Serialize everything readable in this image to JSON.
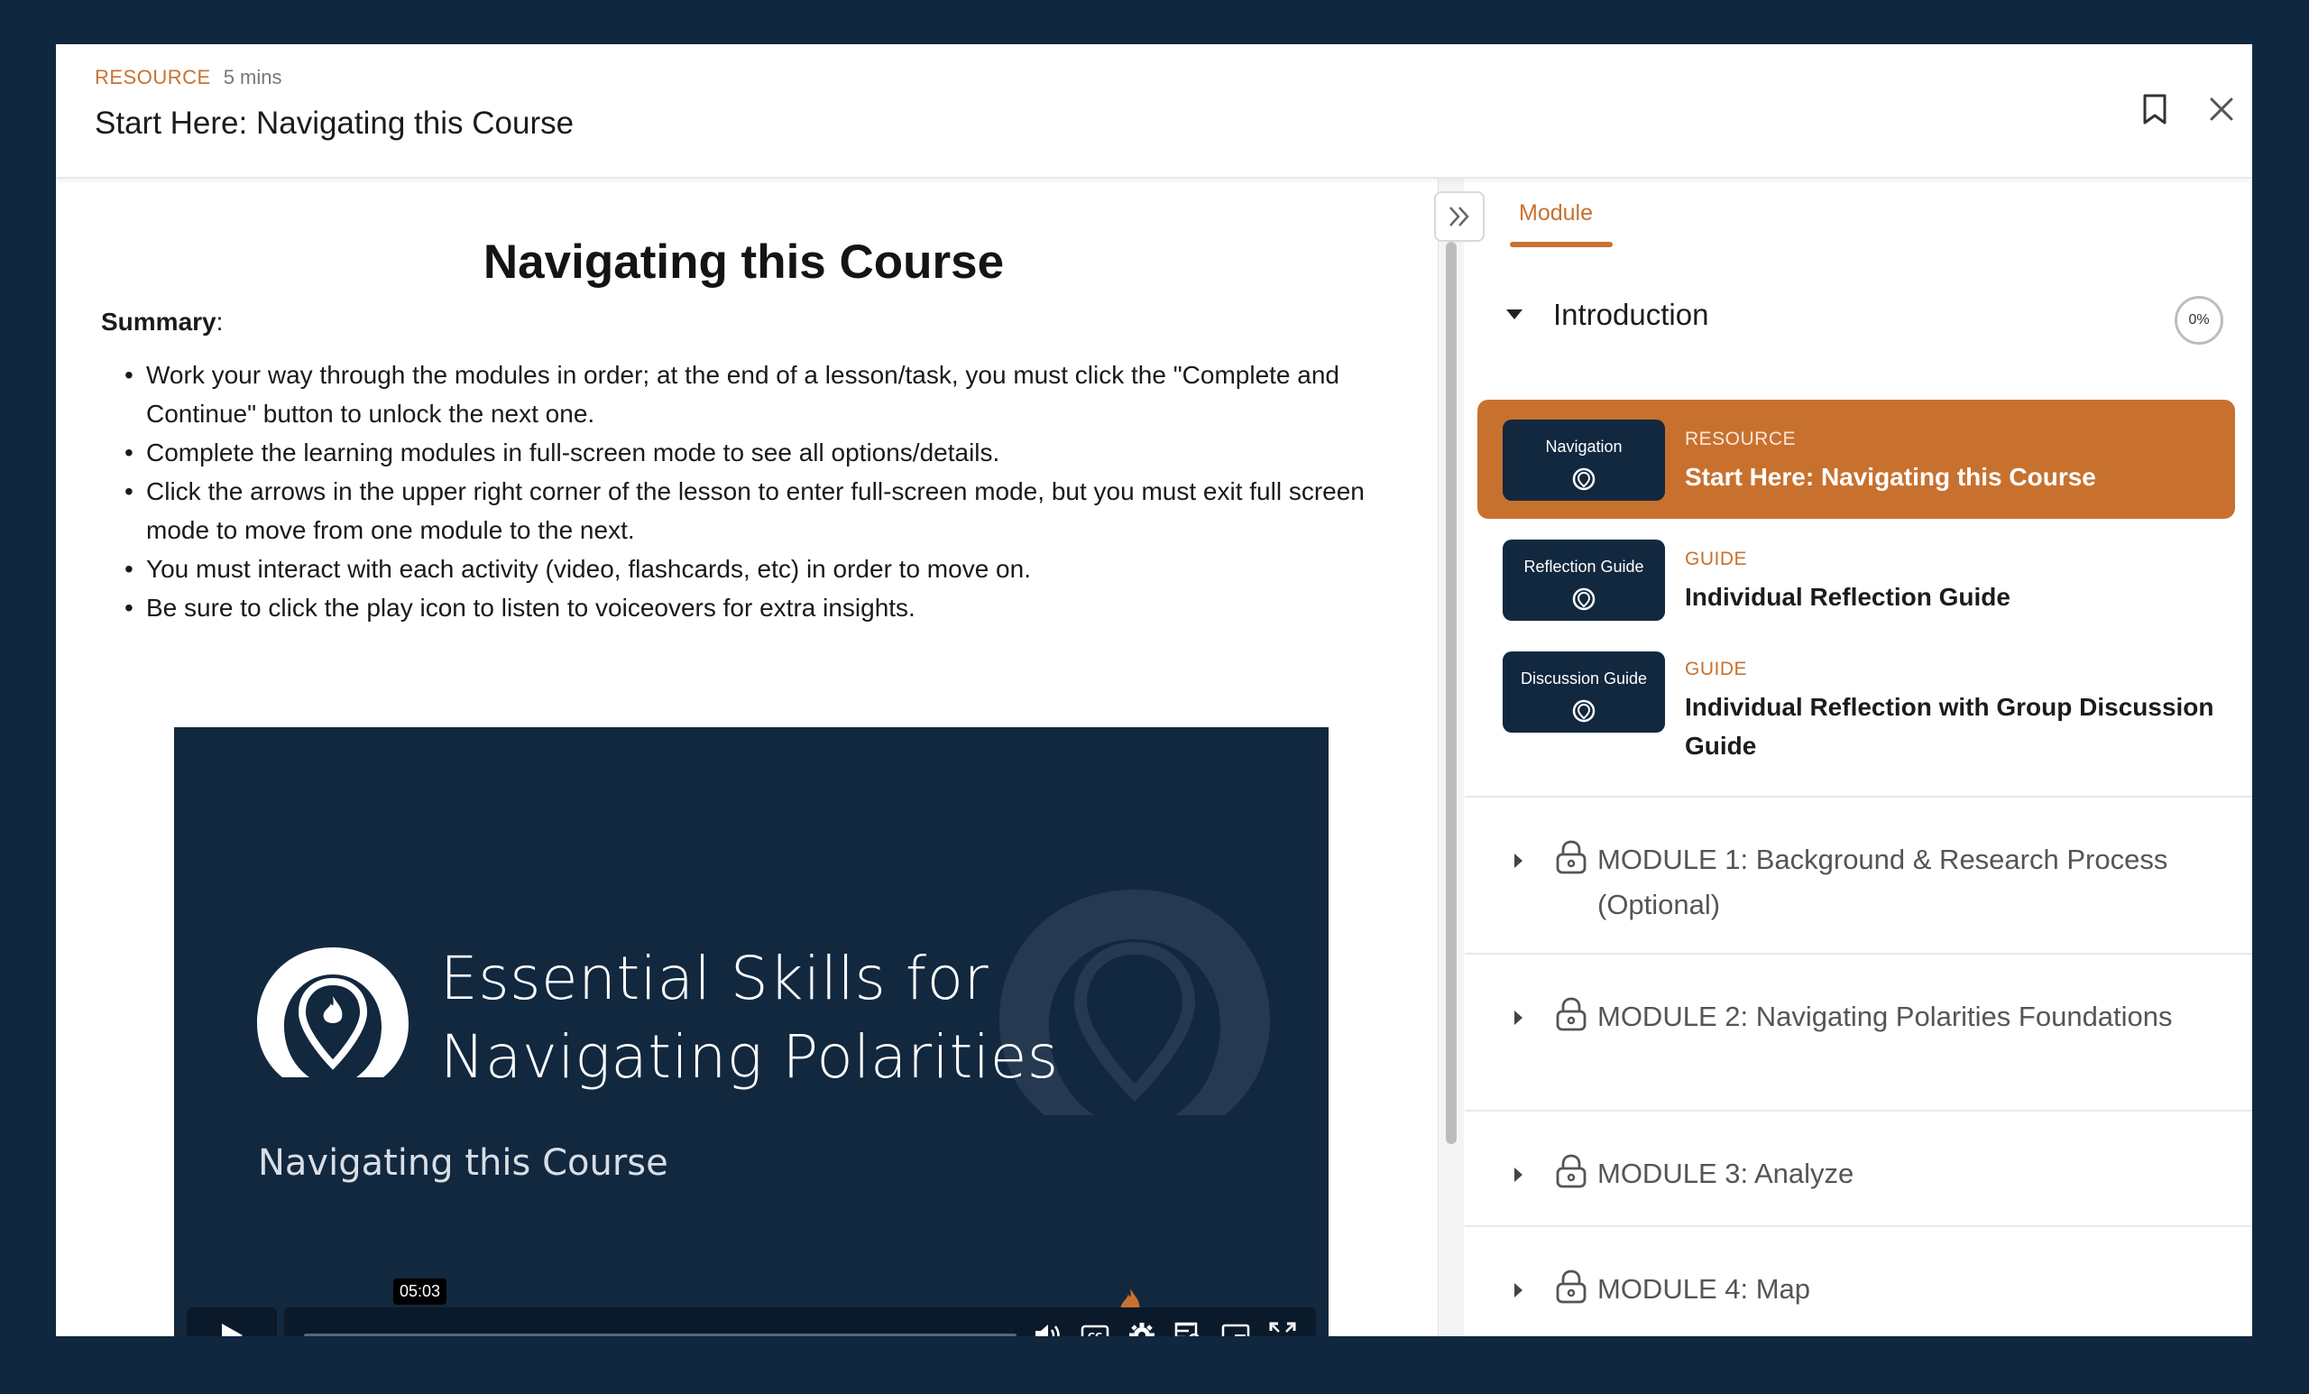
{
  "header": {
    "type": "RESOURCE",
    "duration": "5 mins",
    "title": "Start Here: Navigating this Course"
  },
  "lesson": {
    "title": "Navigating this Course",
    "summary_label": "Summary",
    "summary_colon": ":",
    "bullets": [
      "Work your way through the modules in order; at the end of a lesson/task, you must click the \"Complete and Continue\" button to unlock the next one.",
      "Complete the learning modules in full-screen mode to see all options/details.",
      "Click the arrows in the upper right corner of the lesson to enter full-screen mode, but you must exit full screen mode to move from one module to the next.",
      "You must interact with each activity (video, flashcards, etc) in order to move on.",
      "Be sure to click the play icon to listen to voiceovers for extra insights."
    ]
  },
  "video": {
    "title_line1": "Essential Skills for",
    "title_line2": "Navigating Polarities",
    "subtitle": "Navigating this Course",
    "time_tooltip": "05:03",
    "progress": 0
  },
  "sidebar": {
    "tab_label": "Module",
    "intro": {
      "title": "Introduction",
      "progress": "0%"
    },
    "items": [
      {
        "thumb_label": "Navigation",
        "type": "RESOURCE",
        "title": "Start Here: Navigating this Course",
        "active": true
      },
      {
        "thumb_label": "Reflection Guide",
        "type": "GUIDE",
        "title": "Individual Reflection Guide",
        "active": false
      },
      {
        "thumb_label": "Discussion Guide",
        "type": "GUIDE",
        "title": "Individual Reflection with Group Discussion Guide",
        "active": false
      }
    ],
    "modules": [
      {
        "title": "MODULE 1: Background & Research Process (Optional)"
      },
      {
        "title": "MODULE 2: Navigating Polarities Foundations"
      },
      {
        "title": "MODULE 3: Analyze"
      },
      {
        "title": "MODULE 4: Map"
      }
    ]
  },
  "colors": {
    "accent": "#c8712f",
    "backdrop": "#0f2840",
    "video_bg": "#12283f"
  }
}
